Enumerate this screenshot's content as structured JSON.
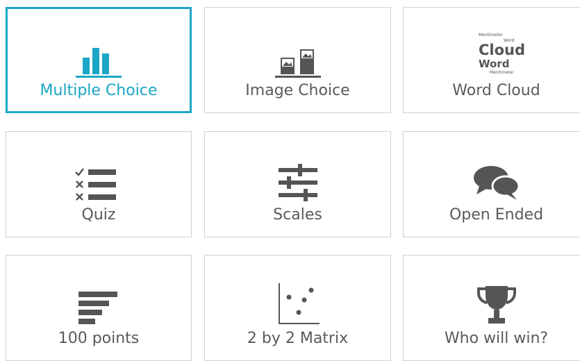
{
  "colors": {
    "accent": "#1aa6c4",
    "icon_gray": "#555555",
    "border": "#cfcfcf"
  },
  "tiles": [
    {
      "label": "Multiple Choice",
      "icon": "bar-chart-icon",
      "selected": true
    },
    {
      "label": "Image Choice",
      "icon": "image-choice-icon",
      "selected": false
    },
    {
      "label": "Word Cloud",
      "icon": "word-cloud-icon",
      "selected": false,
      "icon_words": [
        "Mentimeter",
        "Word",
        "Cloud",
        "Word",
        "Mentimeter"
      ]
    },
    {
      "label": "Quiz",
      "icon": "quiz-checklist-icon",
      "selected": false
    },
    {
      "label": "Scales",
      "icon": "sliders-icon",
      "selected": false
    },
    {
      "label": "Open Ended",
      "icon": "speech-bubbles-icon",
      "selected": false
    },
    {
      "label": "100 points",
      "icon": "horizontal-bars-icon",
      "selected": false
    },
    {
      "label": "2 by 2 Matrix",
      "icon": "scatter-plot-icon",
      "selected": false
    },
    {
      "label": "Who will win?",
      "icon": "trophy-icon",
      "selected": false
    }
  ]
}
